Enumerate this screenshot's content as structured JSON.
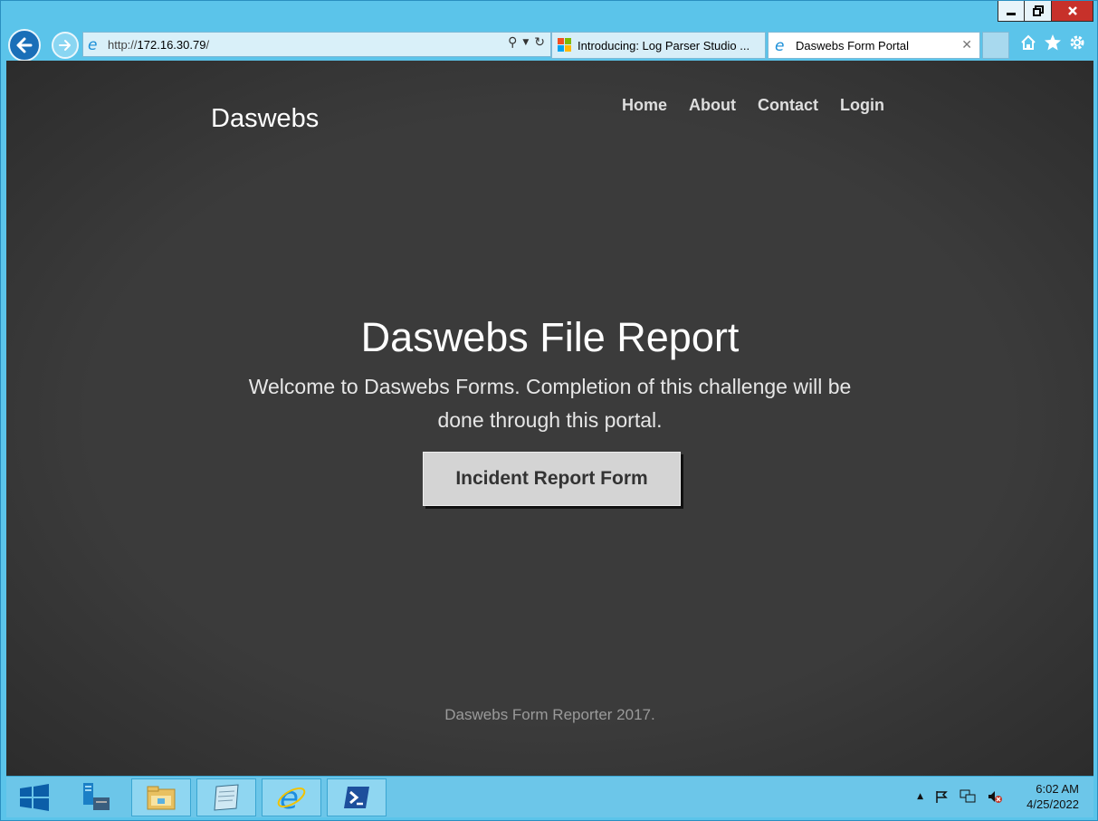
{
  "browser": {
    "address": {
      "prefix": "http://",
      "host": "172.16.30.79",
      "suffix": "/"
    },
    "tabs": [
      {
        "label": "Introducing: Log Parser Studio ...",
        "active": false
      },
      {
        "label": "Daswebs Form Portal",
        "active": true
      }
    ]
  },
  "site": {
    "brand": "Daswebs",
    "nav": [
      "Home",
      "About",
      "Contact",
      "Login"
    ],
    "hero": {
      "title": "Daswebs File Report",
      "lead": "Welcome to Daswebs Forms. Completion of this challenge will be done through this portal.",
      "button": "Incident Report Form"
    },
    "footer": "Daswebs Form Reporter 2017."
  },
  "taskbar": {
    "apps": [
      "start-icon",
      "server-manager-icon",
      "file-explorer-icon",
      "notepad-icon",
      "internet-explorer-icon",
      "powershell-icon"
    ],
    "clock": {
      "time": "6:02 AM",
      "date": "4/25/2022"
    }
  },
  "colors": {
    "page_bg": "#3a3a3a",
    "button_bg": "#d4d4d4",
    "taskbar": "#6cc6e9"
  }
}
